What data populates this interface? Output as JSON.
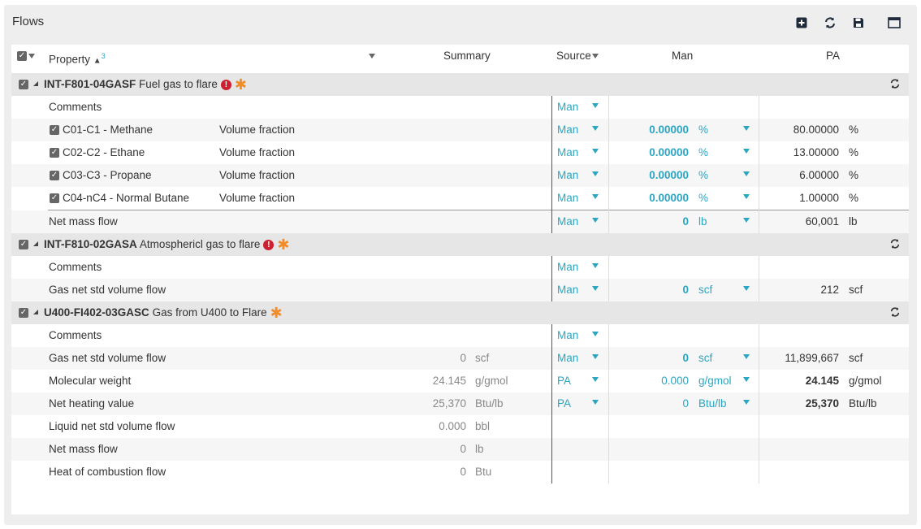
{
  "panel": {
    "title": "Flows"
  },
  "header": {
    "property": "Property",
    "sort_index": "3",
    "summary": "Summary",
    "source": "Source",
    "man": "Man",
    "pa": "PA"
  },
  "groups": [
    {
      "tag": "INT-F801-04GASF",
      "desc": "Fuel gas to flare",
      "rows": [
        {
          "label": "Comments",
          "source": "Man"
        },
        {
          "label": "C01-C1 - Methane",
          "prop": "Volume fraction",
          "source": "Man",
          "man_val": "0.00000",
          "man_unit": "%",
          "pa_val": "80.00000",
          "pa_unit": "%"
        },
        {
          "label": "C02-C2 - Ethane",
          "prop": "Volume fraction",
          "source": "Man",
          "man_val": "0.00000",
          "man_unit": "%",
          "pa_val": "13.00000",
          "pa_unit": "%"
        },
        {
          "label": "C03-C3 - Propane",
          "prop": "Volume fraction",
          "source": "Man",
          "man_val": "0.00000",
          "man_unit": "%",
          "pa_val": "6.00000",
          "pa_unit": "%"
        },
        {
          "label": "C04-nC4 - Normal Butane",
          "prop": "Volume fraction",
          "source": "Man",
          "man_val": "0.00000",
          "man_unit": "%",
          "pa_val": "1.00000",
          "pa_unit": "%"
        },
        {
          "label": "Net mass flow",
          "source": "Man",
          "man_val": "0",
          "man_unit": "lb",
          "pa_val": "60,001",
          "pa_unit": "lb"
        }
      ]
    },
    {
      "tag": "INT-F810-02GASA",
      "desc": "Atmosphericl gas to flare",
      "rows": [
        {
          "label": "Comments",
          "source": "Man"
        },
        {
          "label": "Gas net std volume flow",
          "source": "Man",
          "man_val": "0",
          "man_unit": "scf",
          "pa_val": "212",
          "pa_unit": "scf"
        }
      ]
    },
    {
      "tag": "U400-FI402-03GASC",
      "desc": "Gas from U400 to Flare",
      "rows": [
        {
          "label": "Comments",
          "source": "Man"
        },
        {
          "label": "Gas net std volume flow",
          "sum_val": "0",
          "sum_unit": "scf",
          "source": "Man",
          "man_val": "0",
          "man_unit": "scf",
          "pa_val": "11,899,667",
          "pa_unit": "scf"
        },
        {
          "label": "Molecular weight",
          "sum_val": "24.145",
          "sum_unit": "g/gmol",
          "source": "PA",
          "man_val": "0.000",
          "man_unit": "g/gmol",
          "pa_val": "24.145",
          "pa_unit": "g/gmol"
        },
        {
          "label": "Net heating value",
          "sum_val": "25,370",
          "sum_unit": "Btu/lb",
          "source": "PA",
          "man_val": "0",
          "man_unit": "Btu/lb",
          "pa_val": "25,370",
          "pa_unit": "Btu/lb"
        },
        {
          "label": "Liquid net std volume flow",
          "sum_val": "0.000",
          "sum_unit": "bbl"
        },
        {
          "label": "Net mass flow",
          "sum_val": "0",
          "sum_unit": "lb"
        },
        {
          "label": "Heat of combustion flow",
          "sum_val": "0",
          "sum_unit": "Btu"
        }
      ]
    }
  ],
  "icons": {
    "add": "add-icon",
    "refresh": "refresh-icon",
    "save": "save-icon",
    "window": "window-icon"
  },
  "colors": {
    "accent": "#2aa5c2",
    "error": "#cc1f2f",
    "warning": "#f28c28"
  }
}
